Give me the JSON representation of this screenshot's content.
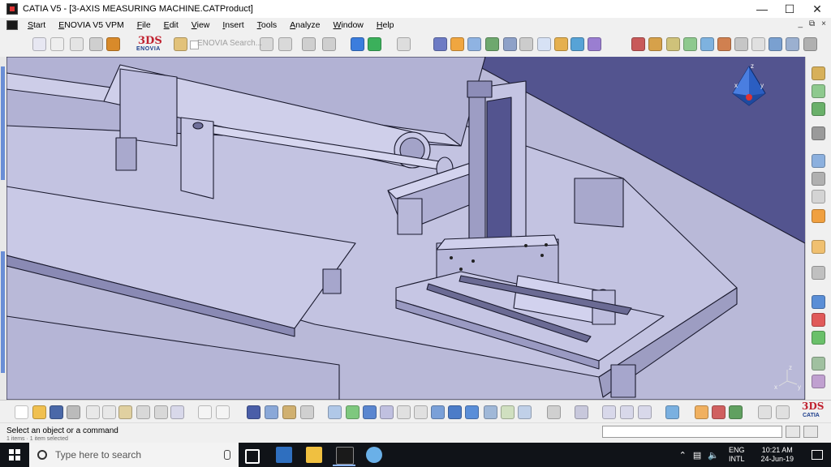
{
  "window": {
    "title": "CATIA V5 - [3-AXIS MEASURING MACHINE.CATProduct]",
    "controls": [
      "minimize-icon",
      "maximize-icon",
      "close-icon"
    ]
  },
  "menu": {
    "items": [
      "Start",
      "ENOVIA V5 VPM",
      "File",
      "Edit",
      "View",
      "Insert",
      "Tools",
      "Analyze",
      "Window",
      "Help"
    ],
    "mdi_controls": [
      "_",
      "⧉",
      "×"
    ]
  },
  "toolbar_top": {
    "enovia_logo": {
      "mark": "3DS",
      "brand": "ENOVIA"
    },
    "search_label": "ENOVIA Search..."
  },
  "viewport": {
    "background": "#53548f",
    "compass_axes": {
      "z": "z",
      "x": "x",
      "y": "y"
    },
    "triad_axes": {
      "z": "z",
      "x": "x",
      "y": "y"
    }
  },
  "toolbar_bottom": {
    "catia_logo": {
      "mark": "3DS",
      "brand": "CATIA"
    }
  },
  "status": {
    "message": "Select an object or a command",
    "sub_message": "1 items · 1 item selected"
  },
  "taskbar": {
    "search_placeholder": "Type here to search",
    "language_line1": "ENG",
    "language_line2": "INTL",
    "time": "10:21 AM",
    "date": "24-Jun-19",
    "tray_icons": [
      "chevron-up-icon",
      "network-icon",
      "volume-icon"
    ]
  },
  "colors": {
    "viewport_bg": "#53548f",
    "part_face": "#c6c6e2",
    "part_edge": "#1a1a2e",
    "taskbar_bg": "#101318",
    "brand_red": "#c0212f",
    "brand_blue": "#1c3e8c"
  }
}
